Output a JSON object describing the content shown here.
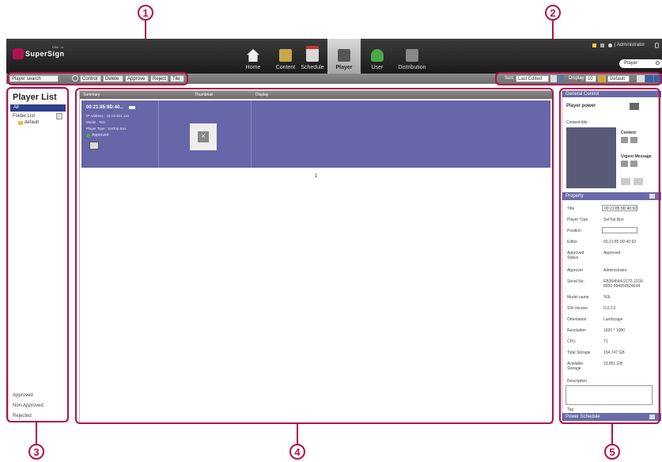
{
  "app": {
    "brand": "SuperSign",
    "brand_sub": "Elite - w"
  },
  "nav": {
    "items": [
      {
        "label": "Home",
        "icon": "home-icon"
      },
      {
        "label": "Content",
        "icon": "content-icon"
      },
      {
        "label": "Schedule",
        "icon": "schedule-icon"
      },
      {
        "label": "Player",
        "icon": "player-icon"
      },
      {
        "label": "User",
        "icon": "user-icon"
      },
      {
        "label": "Distribution",
        "icon": "distribution-icon"
      }
    ],
    "active": "Player"
  },
  "header_right": {
    "user": "| Administrator",
    "search_value": "Player"
  },
  "toolbar": {
    "player_search": "Player search",
    "control": "Control",
    "delete": "Delete",
    "approve": "Approve",
    "reject": "Reject",
    "tile": "Tile",
    "sort_label": "Sort",
    "sort_value": "Last Edited",
    "display_label": "Display",
    "display_value": "10",
    "default_value": "Default"
  },
  "player_list": {
    "title": "Player List",
    "all": "All",
    "folder_list": "Folder List",
    "default_folder": "default",
    "filters": [
      "Approved",
      "Non-Approved",
      "Rejected"
    ]
  },
  "table": {
    "headers": {
      "summary": "Summary",
      "thumbnail": "Thumbnail",
      "display": "Display"
    },
    "row": {
      "name": "00:21:85:9D:40...",
      "ip": "IP Address : 10.19.224.116",
      "model": "Model : 'N3i",
      "type": "Player Type : SetTop Box",
      "status": "Approved"
    },
    "page": "1"
  },
  "general_control": {
    "title": "General Control",
    "player_power": "Player power",
    "content_title": "Content title :",
    "content": "Content",
    "urgent": "Urgent Message"
  },
  "property": {
    "title": "Property",
    "rows": [
      {
        "label": "Title",
        "value": "00:21:85:9D:40:92"
      },
      {
        "label": "Player Type",
        "value": "SetTop Box"
      },
      {
        "label": "Position",
        "value": ""
      },
      {
        "label": "Editor",
        "value": "00:21:85:9D:40:92"
      },
      {
        "label": "Approved Status",
        "value": "Approved"
      },
      {
        "label": "Approver",
        "value": "Administrator"
      },
      {
        "label": "Serial No.",
        "value": "EB364544-9172-11D0-8000-594350524F44"
      },
      {
        "label": "Model name",
        "value": "'N3i"
      },
      {
        "label": "SW Version",
        "value": "0.3.2.0"
      },
      {
        "label": "Orientation",
        "value": "Landscape"
      },
      {
        "label": "Resolution",
        "value": "1920 * 1080"
      },
      {
        "label": "CPU",
        "value": "71"
      },
      {
        "label": "Total Storage",
        "value": "154.747 GB"
      },
      {
        "label": "Available Storage",
        "value": "23.891 GB"
      },
      {
        "label": "Description",
        "value": ""
      },
      {
        "label": "Tag",
        "value": ""
      }
    ]
  },
  "power_schedule": {
    "title": "Power Schedule"
  },
  "callouts": [
    "1",
    "2",
    "3",
    "4",
    "5"
  ],
  "colors": {
    "accent": "#b0124e",
    "highlight": "#6a6aa8",
    "header": "#2a2a2a"
  }
}
